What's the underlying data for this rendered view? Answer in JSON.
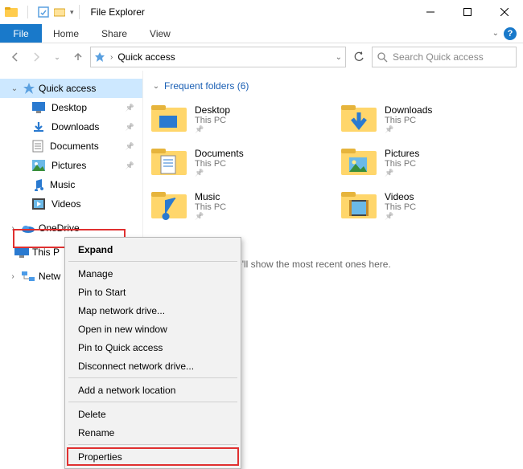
{
  "window": {
    "title": "File Explorer"
  },
  "ribbon": {
    "file": "File",
    "tabs": [
      "Home",
      "Share",
      "View"
    ]
  },
  "address": {
    "location": "Quick access"
  },
  "search": {
    "placeholder": "Search Quick access"
  },
  "sidebar": {
    "quick_access": "Quick access",
    "items": [
      {
        "label": "Desktop"
      },
      {
        "label": "Downloads"
      },
      {
        "label": "Documents"
      },
      {
        "label": "Pictures"
      },
      {
        "label": "Music"
      },
      {
        "label": "Videos"
      }
    ],
    "onedrive": "OneDrive",
    "this_pc": "This P",
    "network": "Netw"
  },
  "content": {
    "section_title": "Frequent folders (6)",
    "folders": [
      {
        "name": "Desktop",
        "sub": "This PC"
      },
      {
        "name": "Downloads",
        "sub": "This PC"
      },
      {
        "name": "Documents",
        "sub": "This PC"
      },
      {
        "name": "Pictures",
        "sub": "This PC"
      },
      {
        "name": "Music",
        "sub": "This PC"
      },
      {
        "name": "Videos",
        "sub": "This PC"
      }
    ],
    "recent_msg": "pened some files, we'll show the most recent ones here."
  },
  "context_menu": {
    "items": [
      "Expand",
      "Manage",
      "Pin to Start",
      "Map network drive...",
      "Open in new window",
      "Pin to Quick access",
      "Disconnect network drive...",
      "Add a network location",
      "Delete",
      "Rename",
      "Properties"
    ]
  }
}
